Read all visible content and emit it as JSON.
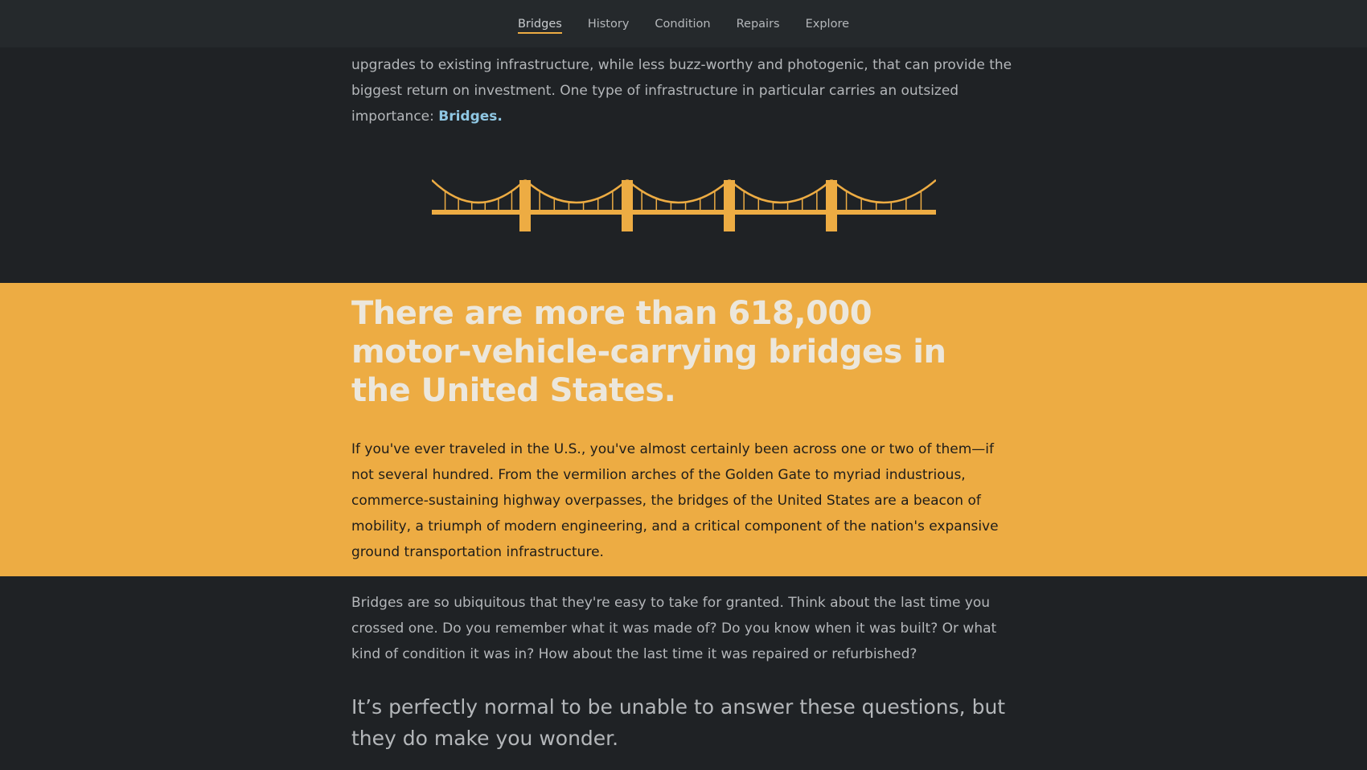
{
  "nav": {
    "items": [
      {
        "label": "Bridges",
        "active": true
      },
      {
        "label": "History",
        "active": false
      },
      {
        "label": "Condition",
        "active": false
      },
      {
        "label": "Repairs",
        "active": false
      },
      {
        "label": "Explore",
        "active": false
      }
    ]
  },
  "intro": {
    "text": "upgrades to existing infrastructure, while less buzz-worthy and photogenic, that can provide the biggest return on investment. One type of infrastructure in particular carries an outsized importance: ",
    "highlight": "Bridges."
  },
  "illustration": {
    "icon": "suspension-bridge-icon",
    "color": "#edac43"
  },
  "feature": {
    "title": "There are more than 618,000 motor-vehicle-carrying bridges in the United States.",
    "text": "If you've ever traveled in the U.S., you've almost certainly been across one or two of them—if not several hundred. From the vermilion arches of the Golden Gate to myriad industrious, commerce-sustaining highway overpasses, the bridges of the United States are a beacon of mobility, a triumph of modern engineering, and a critical component of the nation's expansive ground transportation infrastructure."
  },
  "body": {
    "text": "Bridges are so ubiquitous that they're easy to take for granted. Think about the last time you crossed one. Do you remember what it was made of? Do you know when it was built? Or what kind of condition it was in? How about the last time it was repaired or refurbished?"
  },
  "pullquote": {
    "text": "It’s perfectly normal to be unable to answer these questions, but they do make you wonder."
  },
  "colors": {
    "background": "#1f2225",
    "nav_background": "#25292c",
    "accent": "#edac43",
    "link": "#8fc7e3",
    "body_text": "#b4b7ba"
  }
}
